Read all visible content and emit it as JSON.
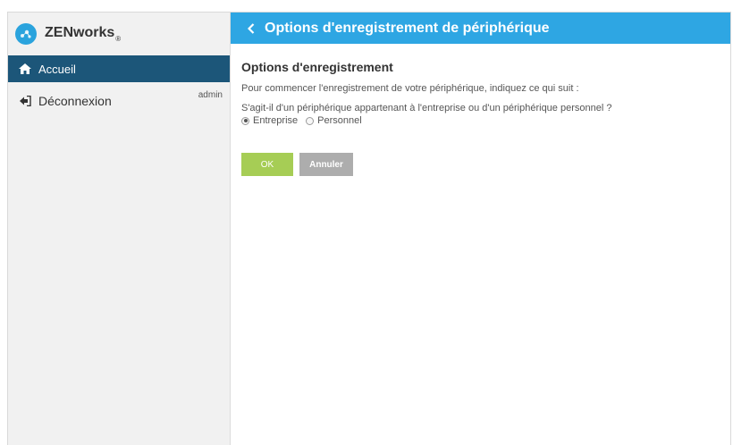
{
  "app": {
    "name": "ZENworks",
    "registered_mark": "®"
  },
  "sidebar": {
    "items": [
      {
        "label": "Accueil",
        "icon": "home-icon",
        "active": true
      },
      {
        "label": "Déconnexion",
        "icon": "logout-icon",
        "active": false
      }
    ],
    "user": "admin"
  },
  "header": {
    "title": "Options d'enregistrement de périphérique"
  },
  "main": {
    "section_title": "Options d'enregistrement",
    "intro": "Pour commencer l'enregistrement de votre périphérique, indiquez ce qui suit :",
    "question": "S'agit-il d'un périphérique appartenant à l'entreprise ou d'un périphérique personnel ?",
    "options": [
      {
        "label": "Entreprise",
        "selected": true
      },
      {
        "label": "Personnel",
        "selected": false
      }
    ],
    "ok_label": "OK",
    "cancel_label": "Annuler"
  },
  "colors": {
    "header_blue": "#2ea6e3",
    "nav_active": "#1c5679",
    "ok_green": "#a6cd55",
    "cancel_gray": "#adadad",
    "logo_blue": "#2aa3dd"
  }
}
